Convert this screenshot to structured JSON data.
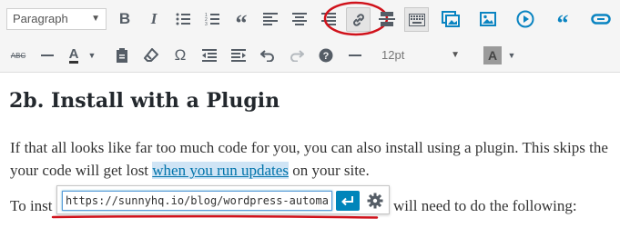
{
  "toolbar": {
    "format_select": "Paragraph",
    "font_size_select": "12pt",
    "text_color_letter": "A",
    "bg_color_letter": "A",
    "strikethrough_label": "ABC",
    "icons_row1": [
      "bold-icon",
      "italic-icon",
      "bullet-list-icon",
      "numbered-list-icon",
      "blockquote-icon",
      "align-left-icon",
      "align-center-icon",
      "align-right-icon",
      "link-icon",
      "read-more-icon",
      "toolbar-toggle-icon",
      "add-gallery-icon",
      "add-image-icon",
      "add-media-icon",
      "add-quote-icon",
      "insert-link-icon"
    ],
    "icons_row2": [
      "strikethrough-icon",
      "horizontal-line-icon",
      "text-color-icon",
      "paste-text-icon",
      "clear-formatting-icon",
      "special-character-icon",
      "outdent-icon",
      "indent-icon",
      "undo-icon",
      "redo-icon",
      "help-icon",
      "horizontal-rule-icon",
      "background-color-icon"
    ]
  },
  "content": {
    "heading": "2b. Install with a Plugin",
    "para1_line1": "If that all looks like far too much code for you, you can also install using a plugin. This skips the",
    "para1_line2_before": "your code will get lost ",
    "para1_link": "when you run updates",
    "para1_line2_after": " on your site.",
    "para2_start": "To inst",
    "para2_end": "will need to do the following:"
  },
  "link_popup": {
    "url_value": "https://sunnyhq.io/blog/wordpress-automatic-u"
  },
  "colors": {
    "accent": "#0085ba",
    "link": "#0073aa",
    "annotation": "#d0121b"
  }
}
